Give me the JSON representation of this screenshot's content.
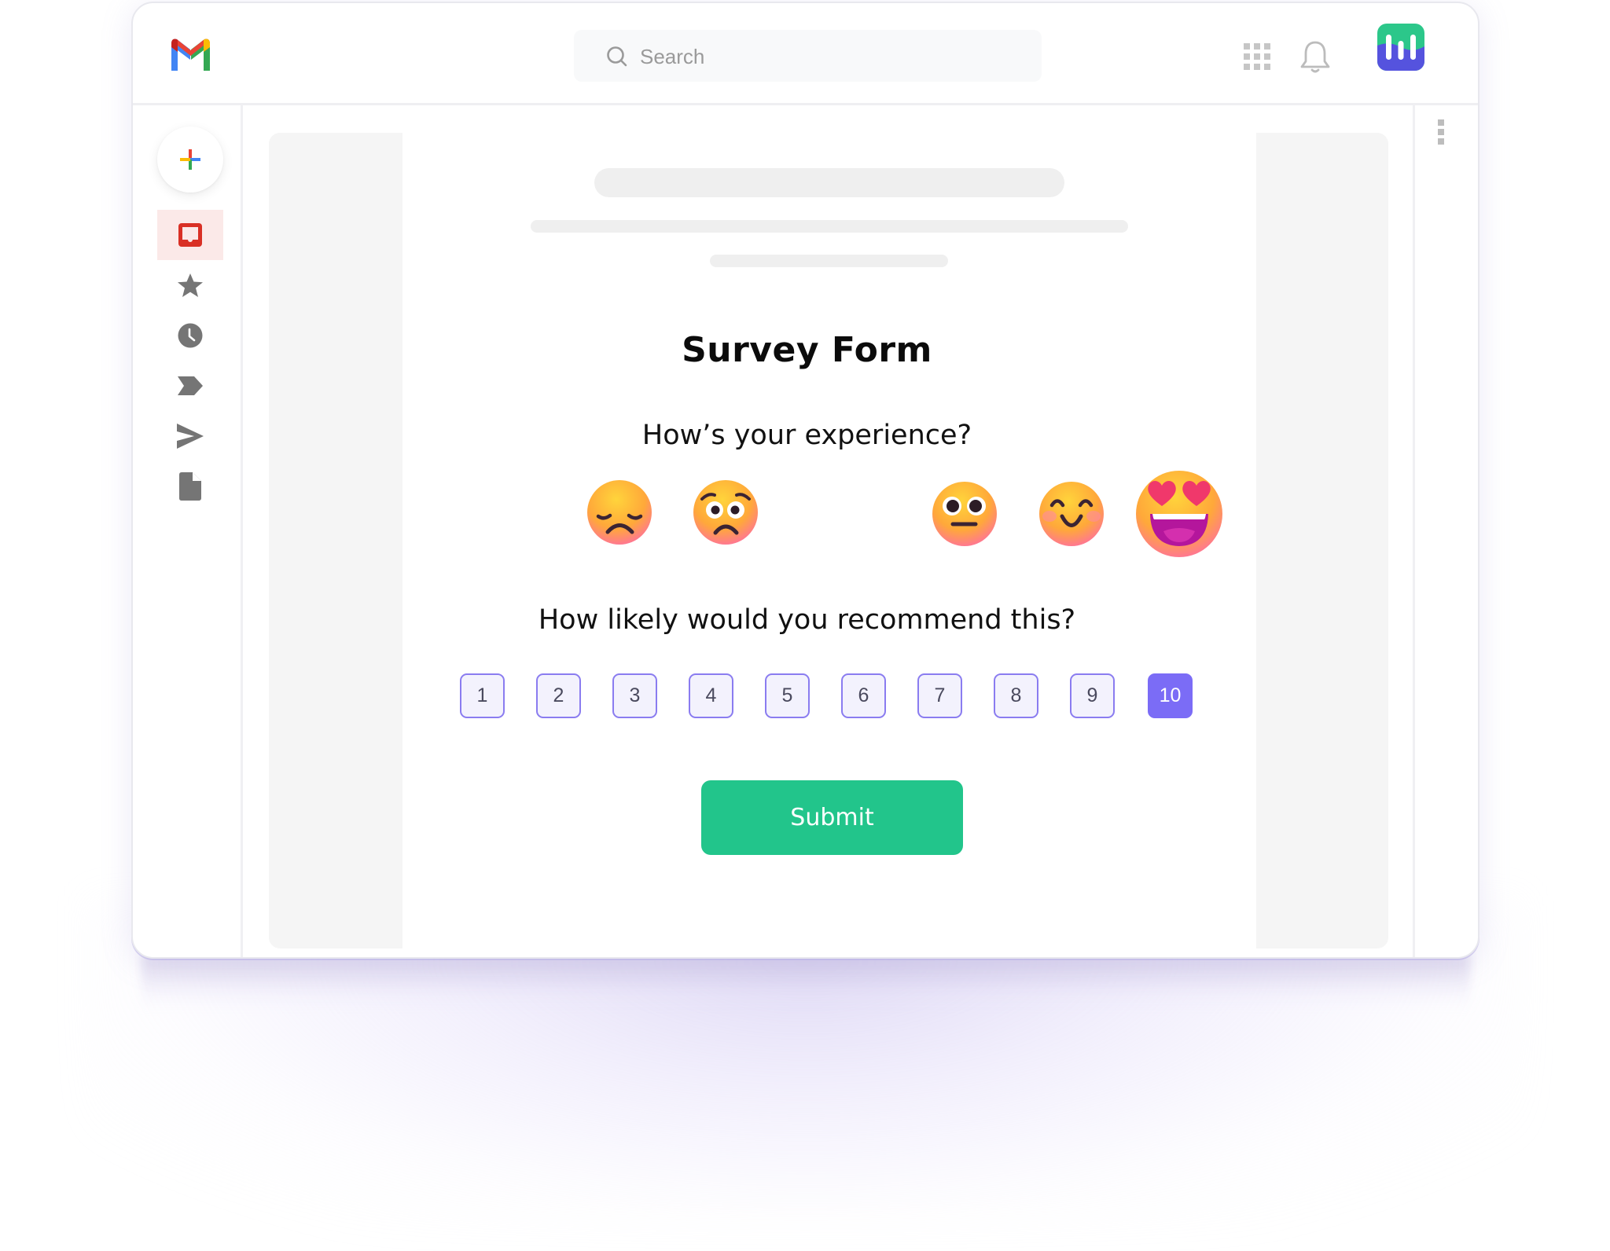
{
  "app": {
    "name": "Gmail",
    "brand_colors": {
      "red": "#ea4335",
      "blue": "#4285f4",
      "green": "#34a853",
      "yellow": "#fbbc04"
    }
  },
  "header": {
    "search": {
      "placeholder": "Search",
      "value": "",
      "icon": "search-icon"
    },
    "icons": [
      "apps-grid-icon",
      "bell-icon"
    ],
    "avatar": {
      "icon": "brand-avatar-icon",
      "colors": {
        "top": "#2cc78a",
        "bottom": "#5553de"
      }
    }
  },
  "sidebar": {
    "compose": {
      "icon": "plus-icon"
    },
    "items": [
      {
        "id": "inbox",
        "icon": "inbox-icon",
        "active": true
      },
      {
        "id": "starred",
        "icon": "star-icon",
        "active": false
      },
      {
        "id": "snoozed",
        "icon": "clock-icon",
        "active": false
      },
      {
        "id": "important",
        "icon": "label-icon",
        "active": false
      },
      {
        "id": "sent",
        "icon": "send-icon",
        "active": false
      },
      {
        "id": "drafts",
        "icon": "document-icon",
        "active": false
      }
    ]
  },
  "right_rail": {
    "icon": "kebab-menu-icon"
  },
  "survey": {
    "title": "Survey Form",
    "experience_question": "How’s your experience?",
    "experience_options": [
      {
        "id": "disappointed",
        "label": "Disappointed face",
        "selected": false
      },
      {
        "id": "worried",
        "label": "Worried face",
        "selected": false
      },
      {
        "id": "neutral",
        "label": "Neutral face",
        "selected": false
      },
      {
        "id": "smiling",
        "label": "Smiling face",
        "selected": false
      },
      {
        "id": "heart-eyes",
        "label": "Heart-eyes face",
        "selected": true
      }
    ],
    "recommend_question": "How likely would you recommend this?",
    "scale": [
      "1",
      "2",
      "3",
      "4",
      "5",
      "6",
      "7",
      "8",
      "9",
      "10"
    ],
    "selected_score": "10",
    "accent_color": "#7b6cf6",
    "submit_label": "Submit",
    "submit_color": "#22c58b"
  }
}
